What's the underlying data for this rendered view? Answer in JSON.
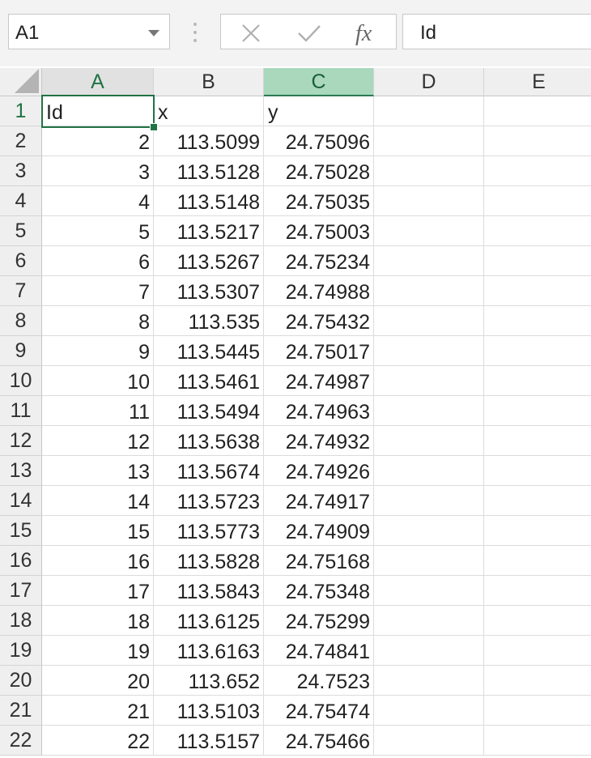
{
  "name_box": {
    "value": "A1"
  },
  "formula_bar": {
    "content": "Id",
    "cancel_icon": "close-icon",
    "enter_icon": "check-icon",
    "function_icon": "fx-icon"
  },
  "columns": [
    "A",
    "B",
    "C",
    "D",
    "E"
  ],
  "selected_column": "C",
  "active_cell": "A1",
  "header_row": {
    "row": "1",
    "cells": [
      "Id",
      "x",
      "y"
    ]
  },
  "rows": [
    {
      "row": "2",
      "a": "2",
      "b": "113.5099",
      "c": "24.75096"
    },
    {
      "row": "3",
      "a": "3",
      "b": "113.5128",
      "c": "24.75028"
    },
    {
      "row": "4",
      "a": "4",
      "b": "113.5148",
      "c": "24.75035"
    },
    {
      "row": "5",
      "a": "5",
      "b": "113.5217",
      "c": "24.75003"
    },
    {
      "row": "6",
      "a": "6",
      "b": "113.5267",
      "c": "24.75234"
    },
    {
      "row": "7",
      "a": "7",
      "b": "113.5307",
      "c": "24.74988"
    },
    {
      "row": "8",
      "a": "8",
      "b": "113.535",
      "c": "24.75432"
    },
    {
      "row": "9",
      "a": "9",
      "b": "113.5445",
      "c": "24.75017"
    },
    {
      "row": "10",
      "a": "10",
      "b": "113.5461",
      "c": "24.74987"
    },
    {
      "row": "11",
      "a": "11",
      "b": "113.5494",
      "c": "24.74963"
    },
    {
      "row": "12",
      "a": "12",
      "b": "113.5638",
      "c": "24.74932"
    },
    {
      "row": "13",
      "a": "13",
      "b": "113.5674",
      "c": "24.74926"
    },
    {
      "row": "14",
      "a": "14",
      "b": "113.5723",
      "c": "24.74917"
    },
    {
      "row": "15",
      "a": "15",
      "b": "113.5773",
      "c": "24.74909"
    },
    {
      "row": "16",
      "a": "16",
      "b": "113.5828",
      "c": "24.75168"
    },
    {
      "row": "17",
      "a": "17",
      "b": "113.5843",
      "c": "24.75348"
    },
    {
      "row": "18",
      "a": "18",
      "b": "113.6125",
      "c": "24.75299"
    },
    {
      "row": "19",
      "a": "19",
      "b": "113.6163",
      "c": "24.74841"
    },
    {
      "row": "20",
      "a": "20",
      "b": "113.652",
      "c": "24.7523"
    },
    {
      "row": "21",
      "a": "21",
      "b": "113.5103",
      "c": "24.75474"
    },
    {
      "row": "22",
      "a": "22",
      "b": "113.5157",
      "c": "24.75466"
    }
  ],
  "colors": {
    "accent": "#217346",
    "selected_header": "#a9d8bd"
  }
}
